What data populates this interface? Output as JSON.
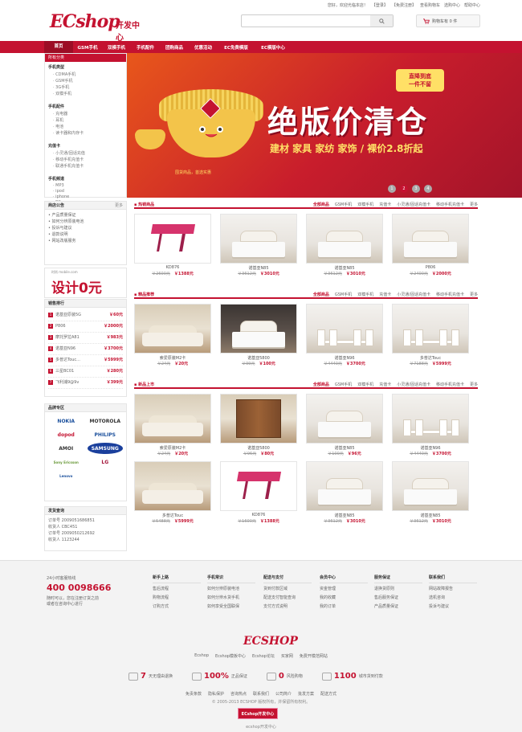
{
  "topbar": {
    "links": [
      "您好，欢迎光临本店！",
      "【登录】",
      "【免费注册】",
      "查看购物车",
      "选购中心",
      "帮助中心"
    ]
  },
  "logo": {
    "brand": "ECshop",
    "suffix": "开发中心"
  },
  "search": {
    "placeholder": ""
  },
  "cart": {
    "label": "购物车有 0 件"
  },
  "nav": {
    "items": [
      "首页",
      "GSM手机",
      "双模手机",
      "手机配件",
      "团购商品",
      "优惠活动",
      "EC免费模版",
      "EC模版中心"
    ]
  },
  "category": {
    "header": "所有分类",
    "groups": [
      {
        "title": "手机类型",
        "items": [
          "CDMA手机",
          "GSM手机",
          "3G手机",
          "双模手机"
        ]
      },
      {
        "title": "手机配件",
        "items": [
          "充电器",
          "耳机",
          "电池",
          "读卡器和内存卡"
        ]
      },
      {
        "title": "充值卡",
        "items": [
          "小灵通/固话充值",
          "移动手机充值卡",
          "联通手机充值卡"
        ]
      },
      {
        "title": "手机频道",
        "items": [
          "MP3",
          "ipod",
          "iphone",
          "PC"
        ]
      }
    ]
  },
  "banner": {
    "title": "绝版价清仓",
    "subtitle": "建材 家具 家纺 家饰 / 裸价2.8折起",
    "bubble1": "直降到底",
    "bubble2": "一件不留",
    "pot_text": "囤货商品，首选实惠",
    "dots": [
      "1",
      "2",
      "3",
      "4"
    ]
  },
  "notice": {
    "header": "商店公告",
    "more": "更多",
    "items": [
      "产品质量保证",
      "如何分辨原装电池",
      "投诉与建议",
      "退款说明",
      "网站改版服务"
    ]
  },
  "ad": {
    "small": "时尚 mobile.com",
    "big": "设计0元"
  },
  "ranking": {
    "header": "销售排行",
    "items": [
      {
        "n": "1",
        "name": "诺基亚原装5G",
        "price": "￥60元"
      },
      {
        "n": "2",
        "name": "P806",
        "price": "￥2000元"
      },
      {
        "n": "3",
        "name": "摩托罗拉A81",
        "price": "￥983元"
      },
      {
        "n": "4",
        "name": "诺基亚N96",
        "price": "￥3700元"
      },
      {
        "n": "5",
        "name": "多普达Touc...",
        "price": "￥5999元"
      },
      {
        "n": "6",
        "name": "三星BC01",
        "price": "￥280元"
      },
      {
        "n": "7",
        "name": "飞利浦9@9v",
        "price": "￥399元"
      }
    ]
  },
  "brands": {
    "header": "品牌专区",
    "items": [
      "NOKIA",
      "MOTOROLA",
      "dopod",
      "PHILIPS",
      "AMOI",
      "SAMSUNG",
      "Sony Ericsson",
      "LG",
      "Lenovo"
    ]
  },
  "order_query": {
    "header": "发货查询",
    "lines": [
      "订单号 2009051686851",
      "收货人 CBC451",
      "订单号 2009050212692",
      "收货人 1123244"
    ]
  },
  "sections": [
    {
      "title": "热销商品",
      "tabs": [
        "全部商品",
        "GSM手机",
        "双模手机",
        "充值卡",
        "小灵通/固话充值卡",
        "移动手机充值卡"
      ],
      "more": "更多",
      "products": [
        {
          "name": "KD876",
          "old": "￥2600元",
          "price": "￥1388元",
          "img": "desk"
        },
        {
          "name": "诺基亚N85",
          "old": "￥3612元",
          "price": "￥3010元",
          "img": "bed"
        },
        {
          "name": "诺基亚N85",
          "old": "￥3612元",
          "price": "￥3010元",
          "img": "bed"
        },
        {
          "name": "P806",
          "old": "￥2400元",
          "price": "￥2000元",
          "img": "bed"
        }
      ]
    },
    {
      "title": "精品推荐",
      "tabs": [
        "全部商品",
        "GSM手机",
        "双模手机",
        "充值卡",
        "小灵通/固话充值卡",
        "移动手机充值卡"
      ],
      "more": "更多",
      "products": [
        {
          "name": "索爱原装M2卡",
          "old": "￥24元",
          "price": "￥20元",
          "img": "sofa"
        },
        {
          "name": "诺基亚5800",
          "old": "￥99元",
          "price": "￥100元",
          "img": "bed-dark"
        },
        {
          "name": "诺基亚N96",
          "old": "￥4440元",
          "price": "￥3700元",
          "img": "dining"
        },
        {
          "name": "多普达Touc",
          "old": "￥7188元",
          "price": "￥5999元",
          "img": "dining"
        }
      ]
    },
    {
      "title": "新品上市",
      "tabs": [
        "全部商品",
        "GSM手机",
        "双模手机",
        "充值卡",
        "小灵通/固话充值卡",
        "移动手机充值卡"
      ],
      "more": "更多",
      "products": [
        {
          "name": "索爱原装M2卡",
          "old": "￥24元",
          "price": "￥20元",
          "img": "sofa"
        },
        {
          "name": "诺基亚5800",
          "old": "￥96元",
          "price": "￥80元",
          "img": "wardrobe"
        },
        {
          "name": "诺基亚N85",
          "old": "￥100元",
          "price": "￥96元",
          "img": "bed"
        },
        {
          "name": "诺基亚N96",
          "old": "￥4440元",
          "price": "￥3700元",
          "img": "dining"
        },
        {
          "name": "多普达Touc",
          "old": "￥5488元",
          "price": "￥5999元",
          "img": "sofa"
        },
        {
          "name": "KD876",
          "old": "￥1600元",
          "price": "￥1388元",
          "img": "desk"
        },
        {
          "name": "诺基亚N85",
          "old": "￥3612元",
          "price": "￥3010元",
          "img": "bed"
        },
        {
          "name": "诺基亚N85",
          "old": "￥3612元",
          "price": "￥3010元",
          "img": "bed"
        }
      ]
    }
  ],
  "footer": {
    "hotline_label": "24小时客服热线",
    "phone": "400 0098666",
    "hotline_note1": "随时可以，您在注册订货之前",
    "hotline_note2": "或者在咨询中心进行",
    "cols": [
      {
        "title": "新手上路",
        "items": [
          "售后流程",
          "购物流程",
          "订购方式"
        ]
      },
      {
        "title": "手机常识",
        "items": [
          "如何分辨原装电池",
          "如何分辨水货手机",
          "如何享受全国联保"
        ]
      },
      {
        "title": "配送与支付",
        "items": [
          "货到付款区域",
          "配送支付智能查询",
          "支付方式说明"
        ]
      },
      {
        "title": "会员中心",
        "items": [
          "资金管理",
          "我的收藏",
          "我的订单"
        ]
      },
      {
        "title": "服务保证",
        "items": [
          "退换货原则",
          "售后服务保证",
          "产品质量保证"
        ]
      },
      {
        "title": "联系我们",
        "items": [
          "网站故障报告",
          "选机咨询",
          "投诉与建议"
        ]
      }
    ],
    "logo": "ECSHOP",
    "links1": [
      "Ecshop",
      "Ecshop模板中心",
      "Ecshop论坛",
      "买家网",
      "免费开模范网站"
    ],
    "badges": [
      {
        "big": "7",
        "text": "天无理由退换"
      },
      {
        "big": "100%",
        "text": "正品保证"
      },
      {
        "big": "0",
        "text": "风险购物"
      },
      {
        "big": "1100",
        "text": "城市货到付款"
      }
    ],
    "links2": [
      "免责条款",
      "隐私保护",
      "咨询热点",
      "联系我们",
      "公司简介",
      "批发方案",
      "配送方式"
    ],
    "copyright": "© 2005-2013 ECSHOP 版权所有，并保留所有权利。",
    "seal": "ECshop开发中心",
    "bottom": "ecshop开发中心"
  }
}
